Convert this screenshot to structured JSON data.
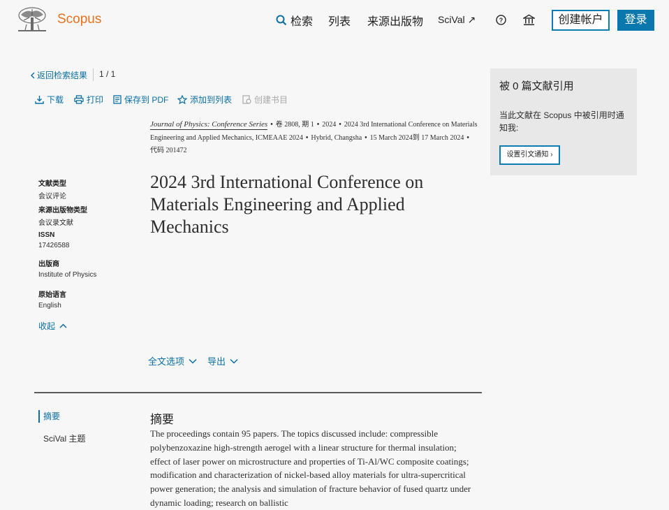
{
  "header": {
    "brand": "Scopus",
    "nav": {
      "search": "检索",
      "lists": "列表",
      "sources": "来源出版物",
      "scival": "SciVal ↗"
    },
    "create_account": "创建帐户",
    "login": "登录"
  },
  "back_link": "返回检索结果",
  "pager": "1 / 1",
  "toolbar": {
    "download": "下载",
    "print": "打印",
    "save_pdf": "保存到 PDF",
    "add_list": "添加到列表",
    "create_bib": "创建书目"
  },
  "meta": {
    "journal": "Journal of Physics: Conference Series",
    "volume": "卷 2808, 期 1",
    "year": "2024",
    "conference": "2024 3rd International Conference on Materials Engineering and Applied Mechanics, ICMEAAE 2024",
    "location": "Hybrid, Changsha",
    "dates": "15 March 2024到 17 March 2024",
    "code": "代码 201472"
  },
  "title": "2024 3rd International Conference on Materials Engineering and Applied Mechanics",
  "info": {
    "doc_type_label": "文献类型",
    "doc_type": "会议评论",
    "source_type_label": "来源出版物类型",
    "source_type": "会议录文献",
    "issn_label": "ISSN",
    "issn": "17426588",
    "publisher_label": "出版商",
    "publisher": "Institute of Physics",
    "language_label": "原始语言",
    "language": "English",
    "collapse": "收起"
  },
  "options": {
    "full_text": "全文选项",
    "export": "导出"
  },
  "sidenav": {
    "abstract": "摘要",
    "scival_topics": "SciVal 主题"
  },
  "abstract": {
    "heading": "摘要",
    "text": "The proceedings contain 95 papers. The topics discussed include: compressible polybenzoxazine high-strength aerogel with a linear structure for thermal insulation; effect of laser power on microstructure and properties of Ti-Al/WC composite coatings; modification and characterization of nickel-based alloy materials for ultra-supercritical power generation; the analysis and simulation of fracture behavior of fused quartz under dynamic loading; research on ballistic"
  },
  "citations": {
    "heading": "被 0 篇文献引用",
    "notice": "当此文献在 Scopus 中被引用时通知我:",
    "button": "设置引文通知 ›"
  },
  "colors": {
    "brand": "#e9711c",
    "link": "#0b6fa3",
    "primary": "#0a77ad"
  }
}
